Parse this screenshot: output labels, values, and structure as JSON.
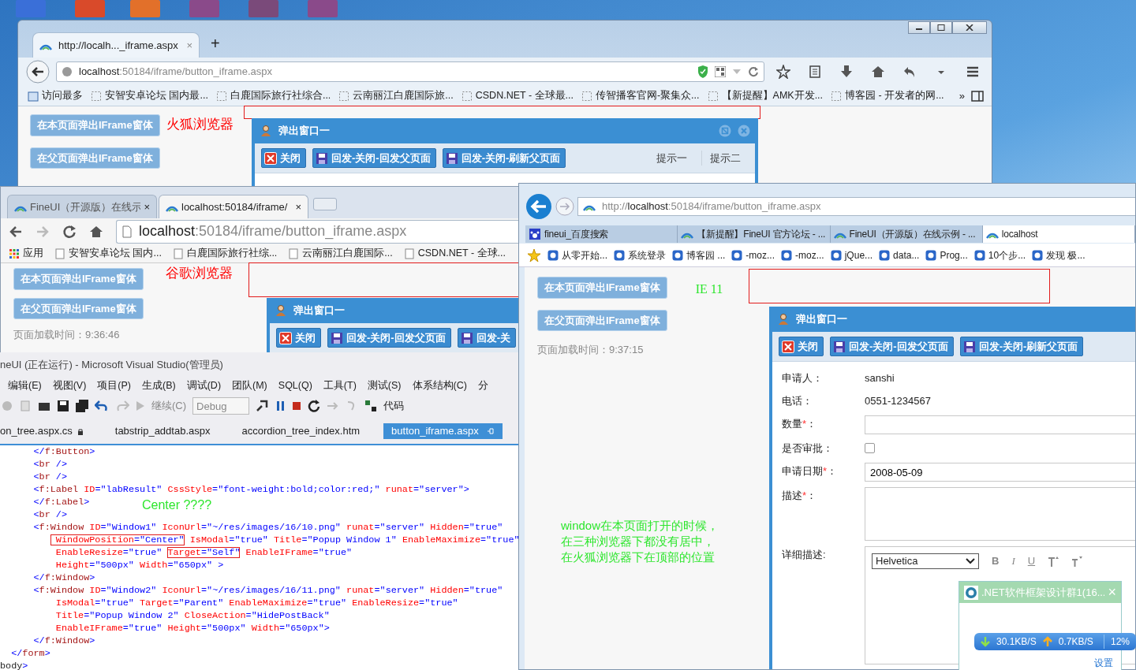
{
  "firefox": {
    "tab_title": "http://localh..._iframe.aspx",
    "tab_close": "×",
    "new_tab": "+",
    "url_host": "localhost",
    "url_rest": ":50184/iframe/button_iframe.aspx",
    "bookmarks": [
      "访问最多",
      "安智安卓论坛 国内最...",
      "白鹿国际旅行社综合...",
      "云南丽江白鹿国际旅...",
      "CSDN.NET - 全球最...",
      "传智播客官网-聚集众...",
      "【新提醒】AMK开发...",
      "博客园 - 开发者的网..."
    ],
    "bookmarks_more": "»",
    "page_buttons": [
      "在本页面弹出IFrame窗体",
      "在父页面弹出IFrame窗体"
    ],
    "browser_label": "火狐浏览器",
    "popup": {
      "title": "弹出窗口一",
      "buttons": [
        {
          "kind": "close",
          "label": "关闭"
        },
        {
          "kind": "save",
          "label": "回发-关闭-回发父页面"
        },
        {
          "kind": "save",
          "label": "回发-关闭-刷新父页面"
        }
      ],
      "tips": [
        "提示一",
        "提示二"
      ]
    }
  },
  "chrome": {
    "tabs": [
      {
        "label": "FineUI（开源版）在线示",
        "close": "×",
        "selected": false
      },
      {
        "label": "localhost:50184/iframe/",
        "close": "×",
        "selected": true
      }
    ],
    "url_host": "localhost",
    "url_rest": ":50184/iframe/button_iframe.aspx",
    "bookmarks": [
      "应用",
      "安智安卓论坛 国内...",
      "白鹿国际旅行社综...",
      "云南丽江白鹿国际...",
      "CSDN.NET - 全球..."
    ],
    "page_buttons": [
      "在本页面弹出IFrame窗体",
      "在父页面弹出IFrame窗体"
    ],
    "browser_label": "谷歌浏览器",
    "load_time": "页面加载时间：9:36:46",
    "popup": {
      "title": "弹出窗口一",
      "buttons": [
        {
          "kind": "close",
          "label": "关闭"
        },
        {
          "kind": "save",
          "label": "回发-关闭-回发父页面"
        },
        {
          "kind": "save",
          "label": "回发-关"
        }
      ]
    }
  },
  "vs": {
    "title": "neUI (正在运行) - Microsoft Visual Studio(管理员)",
    "menu": [
      "编辑(E)",
      "视图(V)",
      "项目(P)",
      "生成(B)",
      "调试(D)",
      "团队(M)",
      "SQL(Q)",
      "工具(T)",
      "测试(S)",
      "体系结构(C)",
      "分"
    ],
    "toolbar": {
      "continue": "继续(C)",
      "config": "Debug",
      "code": "代码"
    },
    "tabs": [
      {
        "label": "on_tree.aspx.cs",
        "selected": false
      },
      {
        "label": "tabstrip_addtab.aspx",
        "selected": false
      },
      {
        "label": "accordion_tree_index.htm",
        "selected": false
      },
      {
        "label": "button_iframe.aspx",
        "selected": true
      }
    ],
    "code_lines": [
      {
        "segments": [
          {
            "text": "      </f:Button>",
            "boxed": false
          }
        ]
      },
      {
        "segments": [
          {
            "text": "      <br />",
            "boxed": false
          }
        ]
      },
      {
        "segments": [
          {
            "text": "      <br />",
            "boxed": false
          }
        ]
      },
      {
        "segments": [
          {
            "text": "      <f:Label ID=\"labResult\" CssStyle=\"font-weight:bold;color:red;\" runat=\"server\">",
            "boxed": false
          }
        ]
      },
      {
        "segments": [
          {
            "text": "      </f:Label>",
            "boxed": false
          }
        ]
      },
      {
        "segments": [
          {
            "text": "      <br />",
            "boxed": false
          }
        ]
      },
      {
        "segments": [
          {
            "text": "      <f:Window ID=\"Window1\" IconUrl=\"~/res/images/16/10.png\" runat=\"server\" Hidden=\"true\"",
            "boxed": false
          }
        ]
      },
      {
        "segments": [
          {
            "text": "          WindowPosition=\"Center\"",
            "boxed": true
          },
          {
            "text": " IsModal=\"true\" Title=\"Popup Window 1\" EnableMaximize=\"true\"",
            "boxed": false
          }
        ]
      },
      {
        "segments": [
          {
            "text": "          EnableResize=\"true\" ",
            "boxed": false
          },
          {
            "text": "Target=\"Self\"",
            "boxed": true
          },
          {
            "text": " EnableIFrame=\"true\"",
            "boxed": false
          }
        ]
      },
      {
        "segments": [
          {
            "text": "          Height=\"500px\" Width=\"650px\" >",
            "boxed": false
          }
        ]
      },
      {
        "segments": [
          {
            "text": "      </f:Window>",
            "boxed": false
          }
        ]
      },
      {
        "segments": [
          {
            "text": "      <f:Window ID=\"Window2\" IconUrl=\"~/res/images/16/11.png\" runat=\"server\" Hidden=\"true\"",
            "boxed": false
          }
        ]
      },
      {
        "segments": [
          {
            "text": "          IsModal=\"true\" Target=\"Parent\" EnableMaximize=\"true\" EnableResize=\"true\"",
            "boxed": false
          }
        ]
      },
      {
        "segments": [
          {
            "text": "          Title=\"Popup Window 2\" CloseAction=\"HidePostBack\"",
            "boxed": false
          }
        ]
      },
      {
        "segments": [
          {
            "text": "          EnableIFrame=\"true\" Height=\"500px\" Width=\"650px\">",
            "boxed": false
          }
        ]
      },
      {
        "segments": [
          {
            "text": "      </f:Window>",
            "boxed": false
          }
        ]
      },
      {
        "segments": [
          {
            "text": "  </form>",
            "boxed": false
          }
        ]
      },
      {
        "segments": [
          {
            "text": "body>",
            "boxed": false
          }
        ]
      }
    ],
    "note": "Center  ????"
  },
  "ie": {
    "url_scheme": "http://",
    "url_host": "localhost",
    "url_rest": ":50184/iframe/button_iframe.aspx",
    "tabs": [
      {
        "label": "fineui_百度搜索",
        "selected": false
      },
      {
        "label": "【新提醒】FineUI 官方论坛 - ...",
        "selected": false
      },
      {
        "label": "FineUI（开源版）在线示例 - ...",
        "selected": false
      },
      {
        "label": "localhost",
        "selected": true
      }
    ],
    "favorites": [
      "从零开始...",
      "系统登录",
      "博客园 ...",
      "-moz...",
      "-moz...",
      "jQue...",
      "data...",
      "Prog...",
      "10个步...",
      "发现 极..."
    ],
    "page_buttons": [
      "在本页面弹出IFrame窗体",
      "在父页面弹出IFrame窗体"
    ],
    "browser_label": "IE 11",
    "load_time": "页面加载时间：9:37:15",
    "note_lines": [
      "window在本页面打开的时候，",
      "在三种浏览器下都没有居中，",
      "在火狐浏览器下在顶部的位置"
    ],
    "popup": {
      "title": "弹出窗口一",
      "buttons": [
        {
          "kind": "close",
          "label": "关闭"
        },
        {
          "kind": "save",
          "label": "回发-关闭-回发父页面"
        },
        {
          "kind": "save",
          "label": "回发-关闭-刷新父页面"
        }
      ],
      "fields": [
        {
          "kind": "text",
          "label": "申请人",
          "colon": "：",
          "value": "sanshi"
        },
        {
          "kind": "text",
          "label": "电话",
          "colon": "：",
          "value": "0551-1234567"
        },
        {
          "kind": "input",
          "label": "数量",
          "required_mark": "*",
          "colon": "："
        },
        {
          "kind": "checkbox",
          "label": "是否审批",
          "colon": "：",
          "checked": false
        },
        {
          "kind": "input",
          "label": "申请日期",
          "required_mark": "*",
          "colon": "：",
          "value": "2008-05-09"
        },
        {
          "kind": "textarea",
          "label": "描述",
          "required_mark": "*",
          "colon": "："
        },
        {
          "kind": "editor",
          "label": "详细描述",
          "colon": ":",
          "font": "Helvetica",
          "tools": [
            "B",
            "I",
            "U"
          ]
        }
      ]
    }
  },
  "qq": {
    "title": ".NET软件框架设计群1(16...",
    "close": "×",
    "download": "30.1KB/S",
    "upload": "0.7KB/S",
    "percent": "12%",
    "settings": "设置"
  }
}
